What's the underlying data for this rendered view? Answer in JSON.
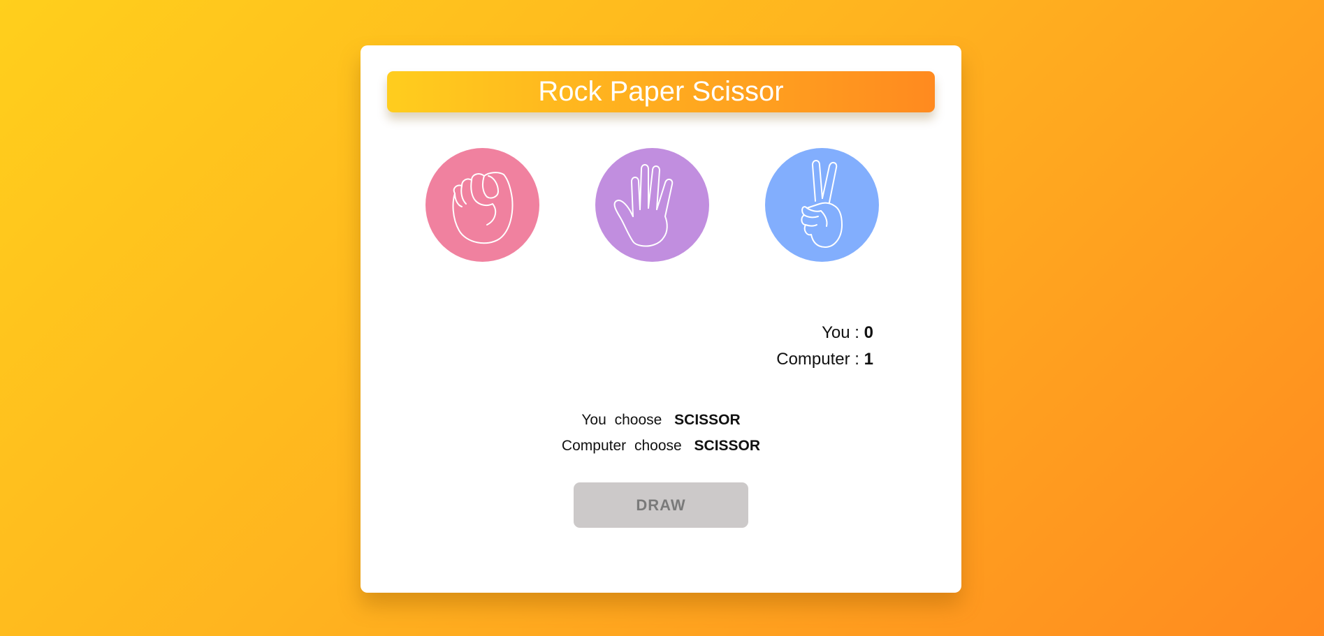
{
  "title": "Rock Paper Scissor",
  "choices": [
    {
      "name": "rock",
      "icon": "fist-icon",
      "color": "#f0819f"
    },
    {
      "name": "paper",
      "icon": "open-hand-icon",
      "color": "#c18edf"
    },
    {
      "name": "scissor",
      "icon": "peace-hand-icon",
      "color": "#82aefd"
    }
  ],
  "score": {
    "you_label": "You :",
    "you_value": "0",
    "computer_label": "Computer :",
    "computer_value": "1"
  },
  "result": {
    "you_text": "You choose",
    "you_choice": "SCISSOR",
    "computer_text": "Computer choose",
    "computer_choice": "SCISSOR"
  },
  "outcome_button": "DRAW"
}
